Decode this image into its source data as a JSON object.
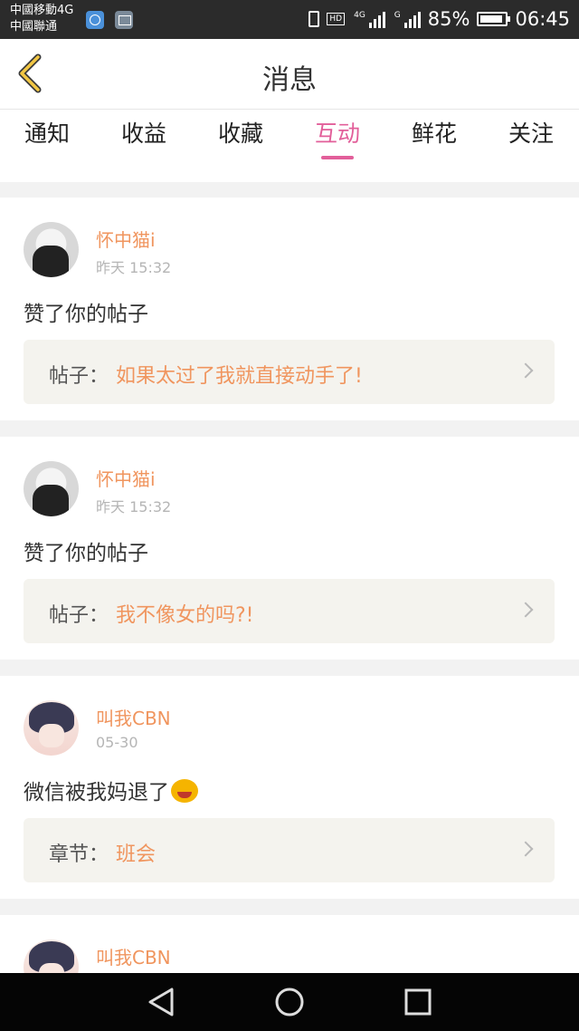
{
  "status_bar": {
    "carrier_1": "中國移動4G",
    "carrier_2": "中國聯通",
    "hd": "HD",
    "net_1": "4G",
    "net_2": "G",
    "battery": "85%",
    "time": "06:45"
  },
  "header": {
    "title": "消息",
    "back_icon": "chevron-left-icon"
  },
  "tabs": [
    {
      "label": "通知"
    },
    {
      "label": "收益"
    },
    {
      "label": "收藏"
    },
    {
      "label": "互动",
      "active": true
    },
    {
      "label": "鲜花"
    },
    {
      "label": "关注"
    }
  ],
  "messages": [
    {
      "username": "怀中猫i",
      "time": "昨天 15:32",
      "text": "赞了你的帖子",
      "ref_label": "帖子：",
      "ref_title": "如果太过了我就直接动手了!"
    },
    {
      "username": "怀中猫i",
      "time": "昨天 15:32",
      "text": "赞了你的帖子",
      "ref_label": "帖子：",
      "ref_title": "我不像女的吗?!"
    },
    {
      "username": "叫我CBN",
      "time": "05-30",
      "text": "微信被我妈退了",
      "emoji": "crying-face-emoji",
      "ref_label": "章节：",
      "ref_title": "班会"
    },
    {
      "username": "叫我CBN"
    }
  ],
  "colors": {
    "accent_pink": "#e25f9a",
    "username_orange": "#f0955e",
    "back_arrow": "#f2c744"
  }
}
